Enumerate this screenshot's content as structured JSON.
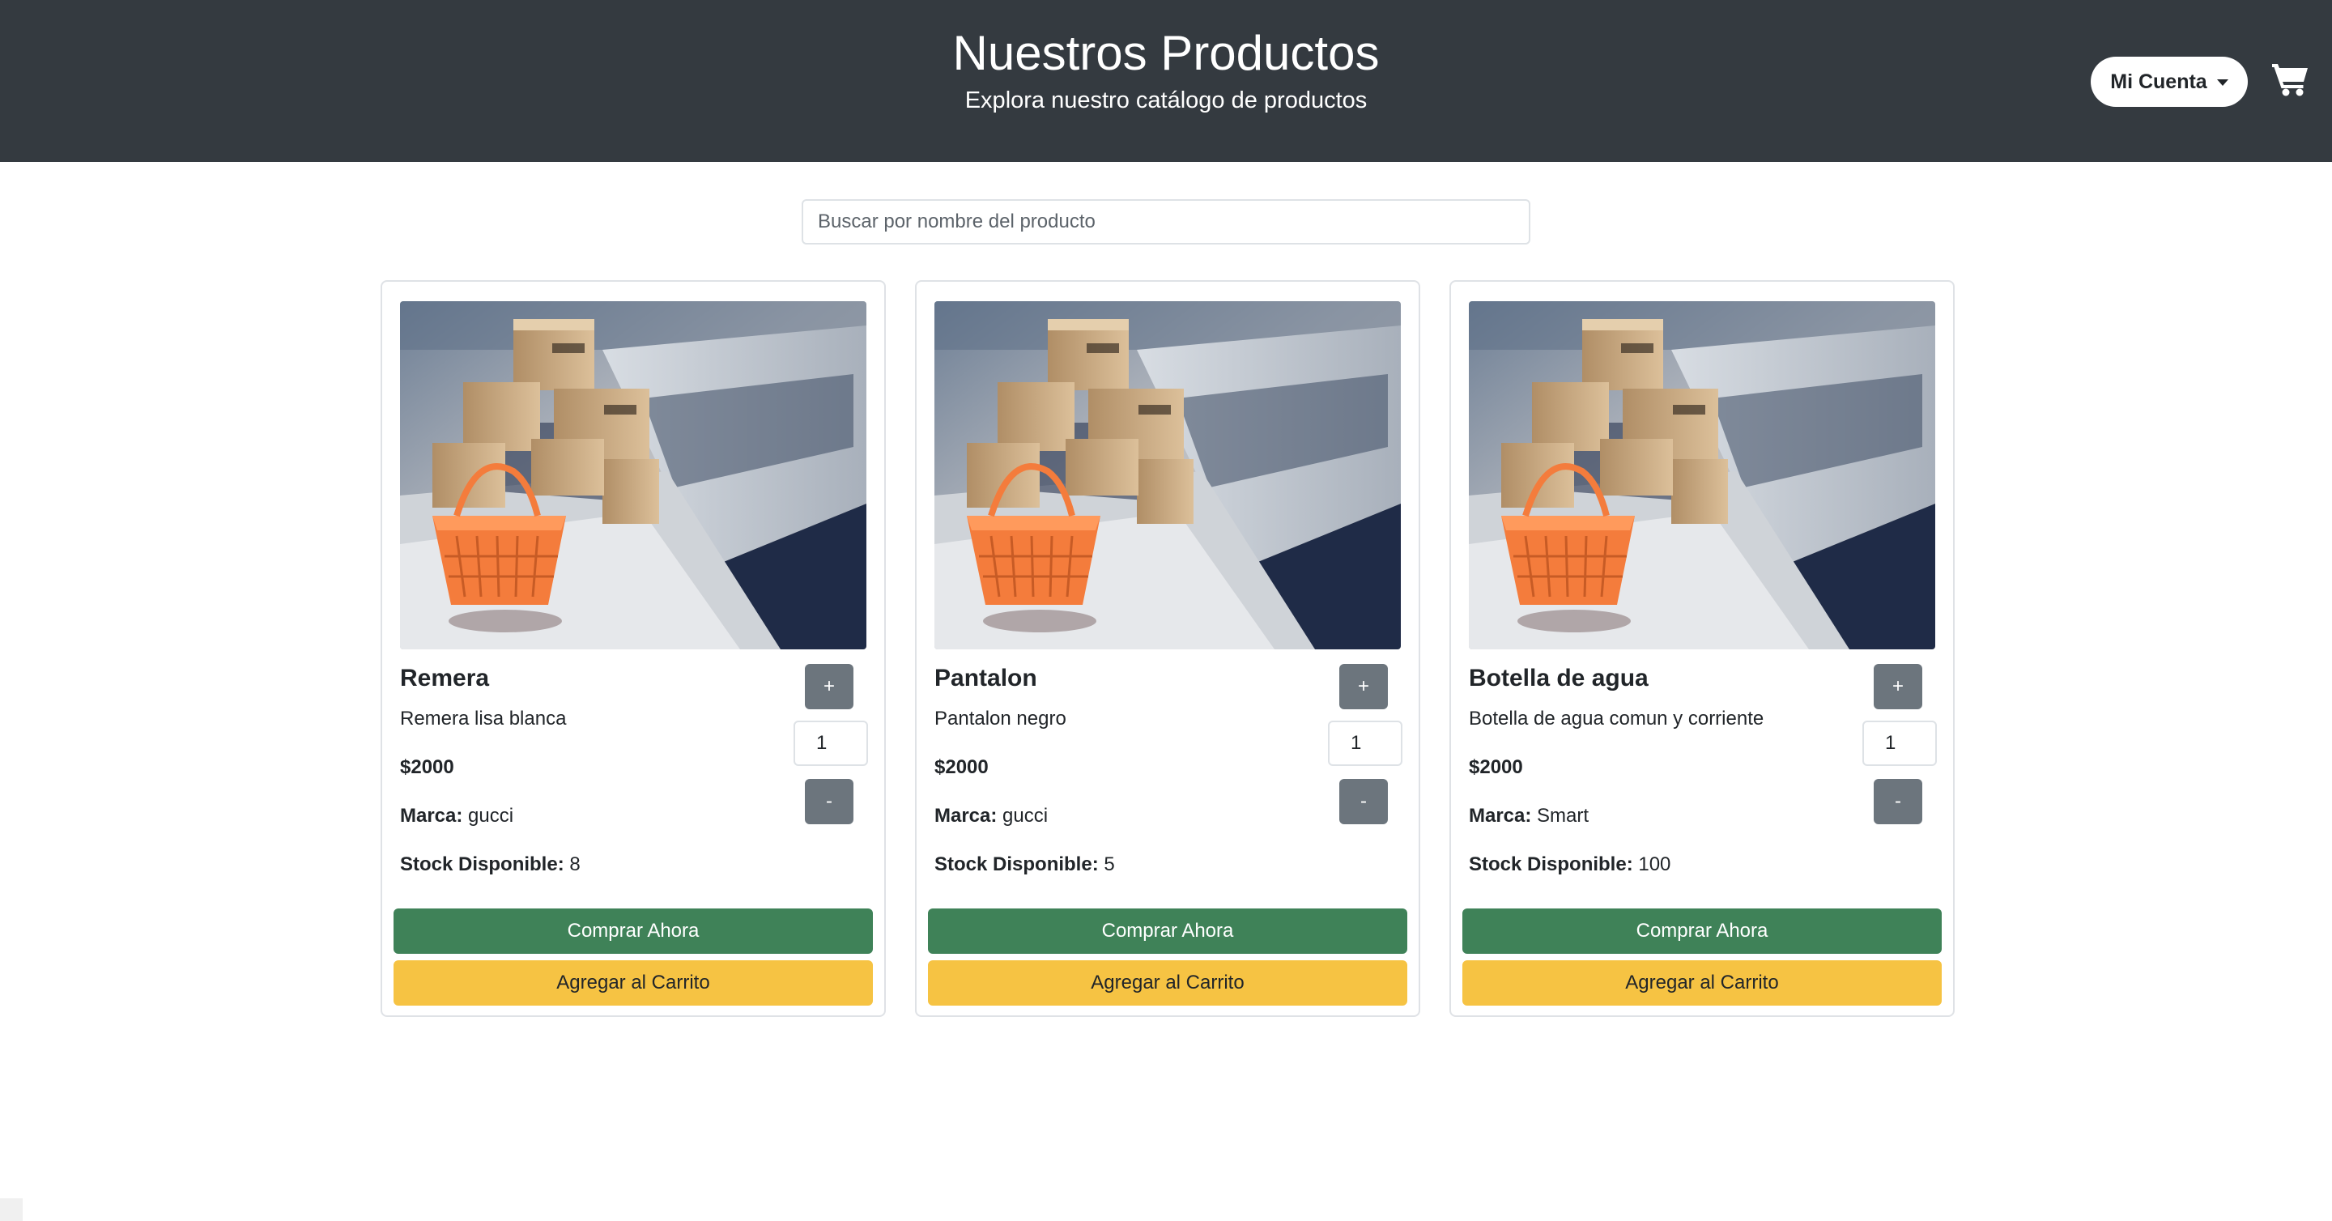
{
  "header": {
    "title": "Nuestros Productos",
    "subtitle": "Explora nuestro catálogo de productos",
    "account_label": "Mi Cuenta",
    "account_icon": "caret-down-icon",
    "cart_icon": "shopping-cart-icon",
    "background_color": "#343a40"
  },
  "search": {
    "placeholder": "Buscar por nombre del producto",
    "value": ""
  },
  "labels": {
    "brand": "Marca:",
    "stock": "Stock Disponible:",
    "plus": "+",
    "minus": "-",
    "buy_now": "Comprar Ahora",
    "add_to_cart": "Agregar al Carrito"
  },
  "products": [
    {
      "name": "Remera",
      "description": "Remera lisa blanca",
      "price": "$2000",
      "brand": "gucci",
      "stock": "8",
      "quantity": "1"
    },
    {
      "name": "Pantalon",
      "description": "Pantalon negro",
      "price": "$2000",
      "brand": "gucci",
      "stock": "5",
      "quantity": "1"
    },
    {
      "name": "Botella de agua",
      "description": "Botella de agua comun y corriente",
      "price": "$2000",
      "brand": "Smart",
      "stock": "100",
      "quantity": "1"
    }
  ],
  "colors": {
    "buy_button": "#3f8258",
    "cart_button": "#f6c343",
    "quantity_button": "#6c757d"
  }
}
